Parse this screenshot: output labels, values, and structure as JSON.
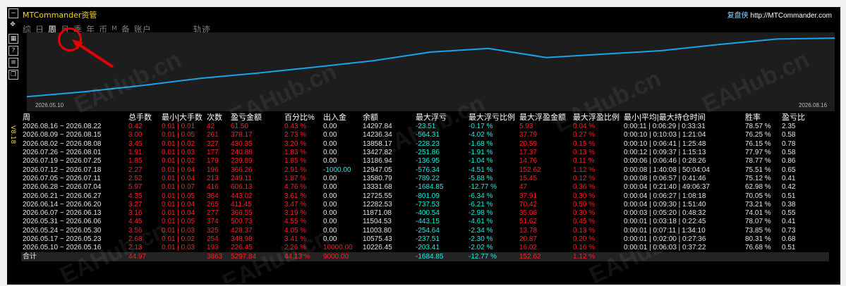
{
  "window": {
    "title": "MTCommander资管",
    "brand_label": "复盘侠",
    "brand_url": "http://MTCommander.com",
    "version": "V8.18"
  },
  "toolbar_icons": [
    "minimize-icon",
    "move-icon",
    "layout-icon",
    "help-icon",
    "export-icon",
    "copy-icon"
  ],
  "tabs": [
    {
      "label": "综"
    },
    {
      "label": "日"
    },
    {
      "label": "周"
    },
    {
      "label": "月"
    },
    {
      "label": "季"
    },
    {
      "label": "年"
    },
    {
      "label": "币"
    },
    {
      "label": "M"
    },
    {
      "label": "备"
    },
    {
      "label": "账户"
    },
    {
      "label": "轨迹"
    }
  ],
  "active_tab": "周",
  "chart_data": {
    "type": "line",
    "x_start_label": "2026.05.10",
    "x_end_label": "2026.08.16",
    "x": [
      "2026.05.10",
      "2026.05.17",
      "2026.05.24",
      "2026.05.31",
      "2026.06.07",
      "2026.06.14",
      "2026.06.21",
      "2026.06.28",
      "2026.07.05",
      "2026.07.12",
      "2026.07.19",
      "2026.07.26",
      "2026.08.02",
      "2026.08.09",
      "2026.08.16"
    ],
    "series": [
      {
        "values": [
          10226.45,
          10575.43,
          11003.8,
          11504.53,
          11871.08,
          12282.53,
          12725.55,
          13331.68,
          13580.79,
          12947.05,
          13186.94,
          13427.82,
          13858.17,
          14236.34,
          14297.84
        ]
      }
    ],
    "ylim": [
      9800,
      14500
    ],
    "grid": false,
    "line_color": "#1aa3e8"
  },
  "table": {
    "headers": [
      "周",
      "总手数",
      "最小|大手数",
      "次数",
      "盈亏金额",
      "百分比%",
      "出入金",
      "余额",
      "最大浮亏",
      "最大浮亏比例",
      "最大浮盈金额",
      "最大浮盈比例",
      "最小|平均|最大持仓时间",
      "胜率",
      "盈亏比"
    ],
    "rows": [
      [
        "2026.08.16 ~ 2026.08.22",
        "0.42",
        "0.01 | 0.01",
        "42",
        "61.50",
        "0.43 %",
        "0.00",
        "14297.84",
        "-23.51",
        "-0.17 %",
        "5.93",
        "0.04 %",
        "0:00:11 | 0:06:29 | 0:33:31",
        "78.57 %",
        "2.35"
      ],
      [
        "2026.08.09 ~ 2026.08.15",
        "3.00",
        "0.01 | 0.05",
        "261",
        "378.17",
        "2.73 %",
        "0.00",
        "14236.34",
        "-564.31",
        "-4.02 %",
        "37.79",
        "0.27 %",
        "0:00:10 | 0:10:03 | 1:21:04",
        "76.25 %",
        "0.58"
      ],
      [
        "2026.08.02 ~ 2026.08.08",
        "3.45",
        "0.01 | 0.02",
        "327",
        "430.35",
        "3.20 %",
        "0.00",
        "13858.17",
        "-228.23",
        "-1.68 %",
        "20.59",
        "0.15 %",
        "0:00:10 | 0:06:41 | 1:25:48",
        "76.15 %",
        "0.78"
      ],
      [
        "2026.07.26 ~ 2026.08.01",
        "1.91",
        "0.01 | 0.03",
        "177",
        "240.88",
        "1.83 %",
        "0.00",
        "13427.82",
        "-251.86",
        "-1.91 %",
        "17.37",
        "0.13 %",
        "0:00:12 | 0:09:37 | 1:15:13",
        "77.97 %",
        "0.58"
      ],
      [
        "2026.07.19 ~ 2026.07.25",
        "1.85",
        "0.01 | 0.02",
        "179",
        "239.89",
        "1.85 %",
        "0.00",
        "13186.94",
        "-136.95",
        "-1.04 %",
        "14.76",
        "0.11 %",
        "0:00:06 | 0:06:46 | 0:28:26",
        "78.77 %",
        "0.86"
      ],
      [
        "2026.07.12 ~ 2026.07.18",
        "2.27",
        "0.01 | 0.04",
        "196",
        "366.26",
        "2.91 %",
        "-1000.00",
        "12947.05",
        "-576.34",
        "-4.51 %",
        "152.62",
        "1.12 %",
        "0:00:08 | 1:40:08 | 50:04:04",
        "75.51 %",
        "0.65"
      ],
      [
        "2026.07.05 ~ 2026.07.11",
        "2.52",
        "0.01 | 0.04",
        "213",
        "249.11",
        "1.87 %",
        "0.00",
        "13580.79",
        "-789.22",
        "-5.88 %",
        "15.45",
        "0.12 %",
        "0:00:08 | 0:06:57 | 0:41:46",
        "75.12 %",
        "0.41"
      ],
      [
        "2026.06.28 ~ 2026.07.04",
        "5.97",
        "0.01 | 0.07",
        "416",
        "606.13",
        "4.76 %",
        "0.00",
        "13331.68",
        "-1684.85",
        "-12.77 %",
        "47",
        "0.36 %",
        "0:00:04 | 0:21:40 | 49:06:37",
        "62.98 %",
        "0.42"
      ],
      [
        "2026.06.21 ~ 2026.06.27",
        "4.35",
        "0.01 | 0.05",
        "364",
        "443.02",
        "3.61 %",
        "0.00",
        "12725.55",
        "-801.09",
        "-6.34 %",
        "37.91",
        "0.30 %",
        "0:00:04 | 0:06:27 | 1:08:18",
        "70.05 %",
        "0.51"
      ],
      [
        "2026.06.14 ~ 2026.06.20",
        "3.27",
        "0.01 | 0.04",
        "265",
        "411.45",
        "3.47 %",
        "0.00",
        "12282.53",
        "-737.53",
        "-6.21 %",
        "70.42",
        "0.59 %",
        "0:00:04 | 0:09:30 | 1:51:40",
        "73.21 %",
        "0.38"
      ],
      [
        "2026.06.07 ~ 2026.06.13",
        "3.16",
        "0.01 | 0.04",
        "277",
        "366.55",
        "3.19 %",
        "0.00",
        "11871.08",
        "-400.54",
        "-2.98 %",
        "35.08",
        "0.30 %",
        "0:00:03 | 0:05:20 | 0:48:32",
        "74.01 %",
        "0.55"
      ],
      [
        "2026.05.31 ~ 2026.06.06",
        "4.45",
        "0.01 | 0.05",
        "374",
        "500.73",
        "4.55 %",
        "0.00",
        "11504.53",
        "-443.15",
        "-4.61 %",
        "51.62",
        "0.45 %",
        "0:00:01 | 0:03:18 | 0:22:45",
        "78.07 %",
        "0.41"
      ],
      [
        "2026.05.24 ~ 2026.05.30",
        "3.56",
        "0.01 | 0.03",
        "325",
        "428.37",
        "4.05 %",
        "0.00",
        "11003.80",
        "-254.64",
        "-2.34 %",
        "13.78",
        "0.13 %",
        "0:00:01 | 0:07:11 | 1:34:10",
        "73.85 %",
        "0.73"
      ],
      [
        "2026.05.17 ~ 2026.05.23",
        "2.68",
        "0.01 | 0.02",
        "254",
        "348.98",
        "3.41 %",
        "0.00",
        "10575.43",
        "-237.51",
        "-2.30 %",
        "20.87",
        "0.20 %",
        "0:00:01 | 0:02:00 | 0:27:36",
        "80.31 %",
        "0.68"
      ],
      [
        "2026.05.10 ~ 2026.05.16",
        "2.13",
        "0.01 | 0.03",
        "193",
        "226.45",
        "2.26 %",
        "10000.00",
        "10226.45",
        "-203.41",
        "-2.02 %",
        "16.02",
        "0.16 %",
        "0:00:01 | 0:06:03 | 0:37:22",
        "76.68 %",
        "0.51"
      ]
    ],
    "total": [
      "合计",
      "44.97",
      "",
      "3863",
      "5297.84",
      "44.13 %",
      "9000.00",
      "",
      "-1684.85",
      "-12.77 %",
      "152.62",
      "1.12 %",
      "",
      "",
      ""
    ]
  },
  "watermark": "EAHub.cn"
}
